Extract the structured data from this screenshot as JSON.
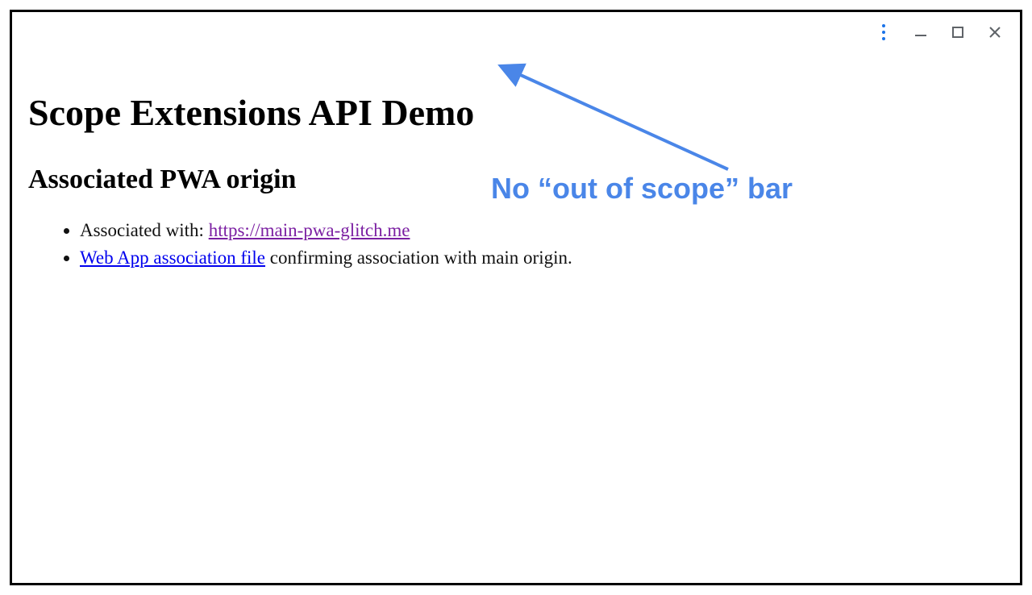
{
  "titlebar": {
    "menu_icon": "kebab-menu",
    "minimize_icon": "minimize",
    "maximize_icon": "maximize",
    "close_icon": "close"
  },
  "page": {
    "heading": "Scope Extensions API Demo",
    "subheading": "Associated PWA origin",
    "list": {
      "item1": {
        "prefix": "Associated with: ",
        "link_text": "https://main-pwa-glitch.me"
      },
      "item2": {
        "link_text": "Web App association file",
        "suffix": " confirming association with main origin."
      }
    }
  },
  "annotation": {
    "label": "No “out of scope” bar",
    "arrow_color": "#4a86e8"
  }
}
